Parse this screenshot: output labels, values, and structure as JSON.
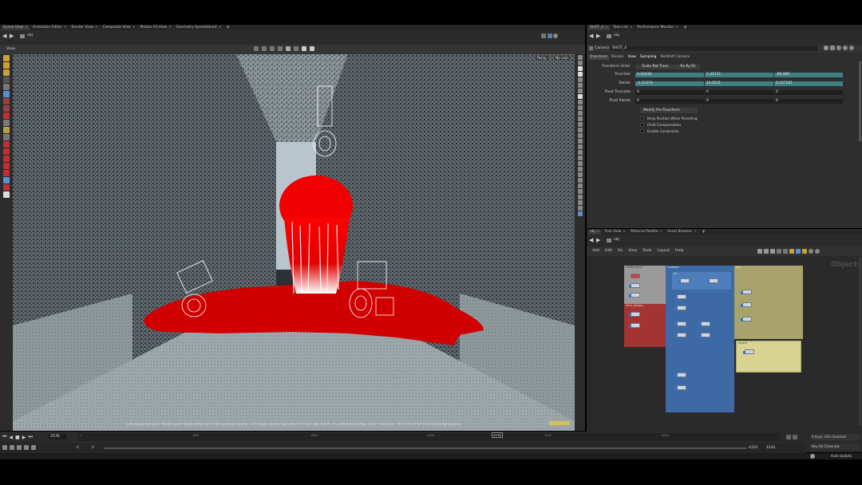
{
  "scene_tabs": [
    "Scene View",
    "Animation Editor",
    "Render View",
    "Composite View",
    "Motion FX View",
    "Geometry Spreadsheet"
  ],
  "right_top_tabs": [
    "SHOT_4",
    "Take List",
    "Performance Monitor"
  ],
  "path_obj": "obj",
  "viewport": {
    "title": "View",
    "persp_btn": "Persp",
    "camera_btn": "No cam",
    "status_text": "Left mouse tumbles. Middle pans. Right dollies. Ctrl+Alt+Left box zooms. Ctrl+Right zooms. Spacebar-Ctrl-Left tilts. Hold L for alternate tumble, dolly, and zoom.    M or Alt+M for First Person Navigation."
  },
  "camera_node": {
    "type": "Camera",
    "name": "SHOT_4"
  },
  "param_tabs": [
    "Transform",
    "Render",
    "View",
    "Sampling",
    "Redshift Camera"
  ],
  "transform_order": {
    "label": "Transform Order",
    "value1": "Scale Rot Trans",
    "value2": "Rx Ry Rz"
  },
  "params": [
    {
      "label": "Translate",
      "v": [
        "3.16439",
        "1.32111",
        "-98.068"
      ]
    },
    {
      "label": "Rotate",
      "v": [
        "-1.31374",
        "14.0531",
        "0.237181"
      ]
    },
    {
      "label": "Pivot Translate",
      "v": [
        "0",
        "0",
        "0"
      ]
    },
    {
      "label": "Pivot Rotate",
      "v": [
        "0",
        "0",
        "0"
      ]
    }
  ],
  "modify_pre": "Modify Pre-Transform",
  "checkboxes": [
    "Keep Position When Parenting",
    "Child Compensation",
    "Enable Constraints"
  ],
  "network_tabs": [
    "obj",
    "Tree View",
    "Material Palette",
    "Asset Browser"
  ],
  "network_menu": [
    "Add",
    "Edit",
    "Go",
    "View",
    "Tools",
    "Layout",
    "Help"
  ],
  "network_watermark": "Objects",
  "net_boxes": {
    "scene_setup": "SCENE_SETUP",
    "shot_extras": "SHOT_EXTRAS",
    "cameras": "CAMERAS",
    "geo": "GEO",
    "lights": "LIGHTS",
    "fx": "FX"
  },
  "timeline": {
    "frame": "2576",
    "ticks": [
      "1",
      "800",
      "1600",
      "2400",
      "3200",
      "4000"
    ],
    "start": "0",
    "start2": "0",
    "end": "4320",
    "end2": "4320",
    "marker": "2576"
  },
  "right_status": {
    "keys": "0 keys, 0/0 channels",
    "key_all": "Key All Channels",
    "auto_update": "Auto Update"
  },
  "colors": {
    "accent_teal": "#3f7f84",
    "net_red": "#a43434",
    "net_blue": "#3d6aa5",
    "net_olive": "#a7a36a",
    "net_grey": "#9a9a9a"
  }
}
